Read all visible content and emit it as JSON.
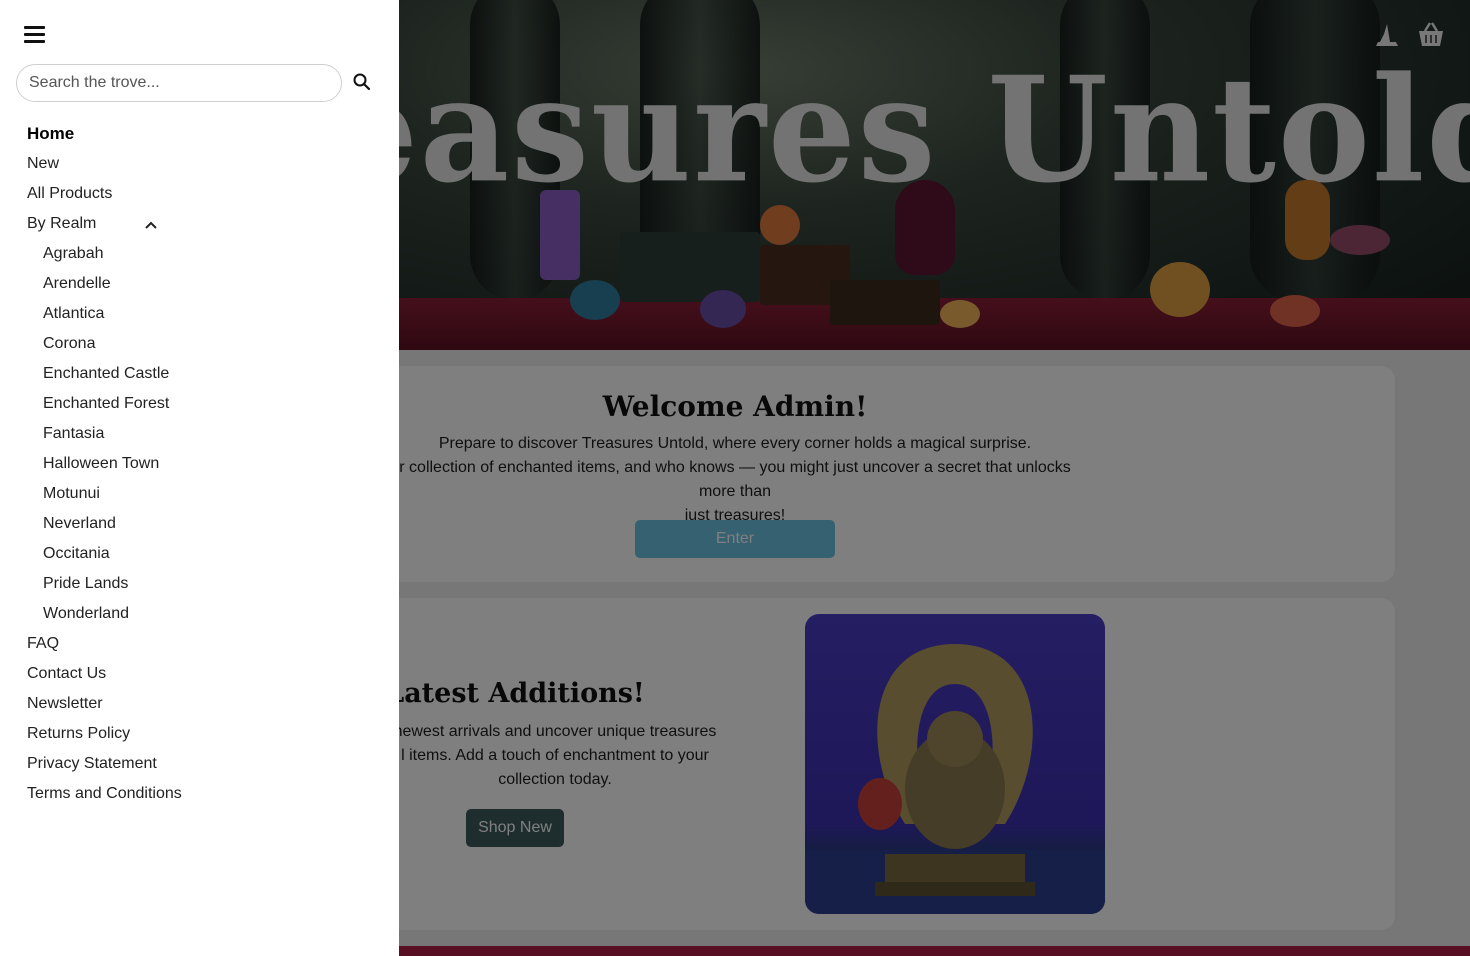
{
  "hero": {
    "title": "easures Untold",
    "icons": [
      "wizard-hat-icon",
      "basket-icon"
    ]
  },
  "welcome": {
    "title": "Welcome Admin!",
    "line1": "Prepare to discover Treasures Untold, where every corner holds a magical surprise.",
    "line2": "r collection of enchanted items, and who knows — you might just uncover a secret that unlocks more than",
    "line3": "just treasures!",
    "button": "Enter"
  },
  "latest": {
    "title": "Latest Additions!",
    "line1": "newest arrivals and uncover unique treasures",
    "line2": "l items. Add a touch of enchantment to your",
    "line3": "collection today.",
    "button": "Shop New"
  },
  "drawer": {
    "search_placeholder": "Search the trove...",
    "items": [
      {
        "label": "Home",
        "active": true
      },
      {
        "label": "New"
      },
      {
        "label": "All Products"
      },
      {
        "label": "By Realm",
        "expanded": true
      },
      {
        "label": "Agrabah",
        "sub": true
      },
      {
        "label": "Arendelle",
        "sub": true
      },
      {
        "label": "Atlantica",
        "sub": true
      },
      {
        "label": "Corona",
        "sub": true
      },
      {
        "label": "Enchanted Castle",
        "sub": true
      },
      {
        "label": "Enchanted Forest",
        "sub": true
      },
      {
        "label": "Fantasia",
        "sub": true
      },
      {
        "label": "Halloween Town",
        "sub": true
      },
      {
        "label": "Motunui",
        "sub": true
      },
      {
        "label": "Neverland",
        "sub": true
      },
      {
        "label": "Occitania",
        "sub": true
      },
      {
        "label": "Pride Lands",
        "sub": true
      },
      {
        "label": "Wonderland",
        "sub": true
      },
      {
        "label": "FAQ"
      },
      {
        "label": "Contact Us"
      },
      {
        "label": "Newsletter"
      },
      {
        "label": "Returns Policy"
      },
      {
        "label": "Privacy Statement"
      },
      {
        "label": "Terms and Conditions"
      }
    ]
  },
  "colors": {
    "accent_button": "#6bc3e3",
    "shop_button": "#3d5a5a",
    "footer_strip": "#b01f48"
  }
}
